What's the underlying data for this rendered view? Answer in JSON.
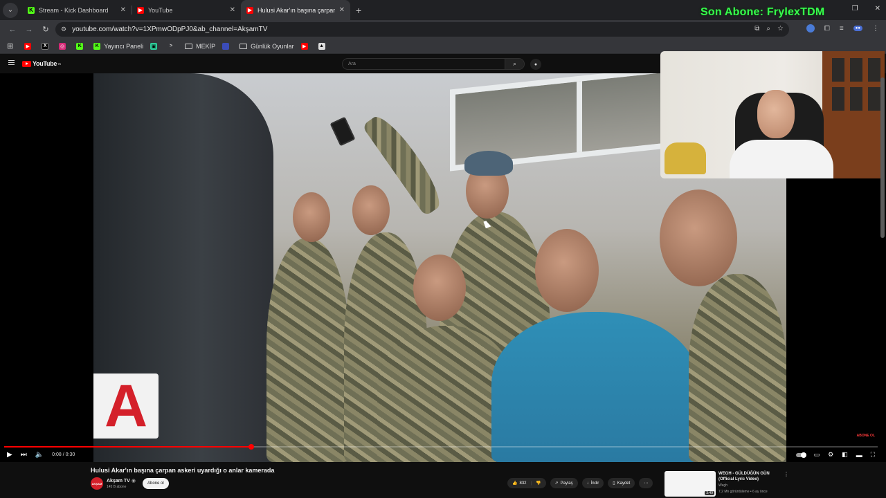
{
  "browser": {
    "tabs": [
      {
        "title": "Stream - Kick Dashboard",
        "favicon": "kick-icon",
        "color": "#53fc18"
      },
      {
        "title": "YouTube",
        "favicon": "youtube-icon",
        "color": "#ff0000"
      },
      {
        "title": "Hulusi Akar'ın başına çarpan as",
        "favicon": "youtube-icon",
        "color": "#ff0000"
      }
    ],
    "url": "youtube.com/watch?v=1XPmwODpPJ0&ab_channel=AkşamTV",
    "bookmarks": [
      {
        "label": "",
        "icon": "youtube-icon"
      },
      {
        "label": "",
        "icon": "x-icon"
      },
      {
        "label": "",
        "icon": "instagram-icon"
      },
      {
        "label": "",
        "icon": "kick-icon"
      },
      {
        "label": "Yayıncı Paneli",
        "icon": "kick-icon"
      },
      {
        "label": "",
        "icon": "app-icon"
      },
      {
        "label": "",
        "icon": "terminal-icon"
      },
      {
        "label": "MEKİP",
        "icon": "folder-icon"
      },
      {
        "label": "",
        "icon": "bookmark-icon"
      },
      {
        "label": "Günlük Oyunlar",
        "icon": "folder-icon"
      },
      {
        "label": "",
        "icon": "youtube-icon"
      },
      {
        "label": "",
        "icon": "image-icon"
      }
    ]
  },
  "overlay": {
    "subscriber_text": "Son Abone: FrylexTDM",
    "color": "#36ff4c"
  },
  "youtube": {
    "logo": "YouTube",
    "logo_sup": "TR",
    "search_placeholder": "Ara",
    "player": {
      "time": "0:08 / 0:30",
      "progress": 0.283,
      "overlay_logo": "A",
      "corner_badge": "ABONE OL"
    },
    "video": {
      "title": "Hulusi Akar'ın başına çarpan askeri uyardığı o anlar kamerada",
      "channel": "Akşam TV",
      "channel_avatar": "AKŞAM",
      "subscribers": "145 B abone",
      "subscribe_label": "Abone ol",
      "likes": "832",
      "share_label": "Paylaş",
      "download_label": "İndir",
      "save_label": "Kaydet"
    },
    "recommendation": {
      "title": "WEGH - GÜLDÜĞÜN GÜN (Official Lyric Video)",
      "channel": "Wegh",
      "meta": "7,2 Mn görüntüleme • 6 ay önce",
      "duration": "3:49"
    }
  }
}
